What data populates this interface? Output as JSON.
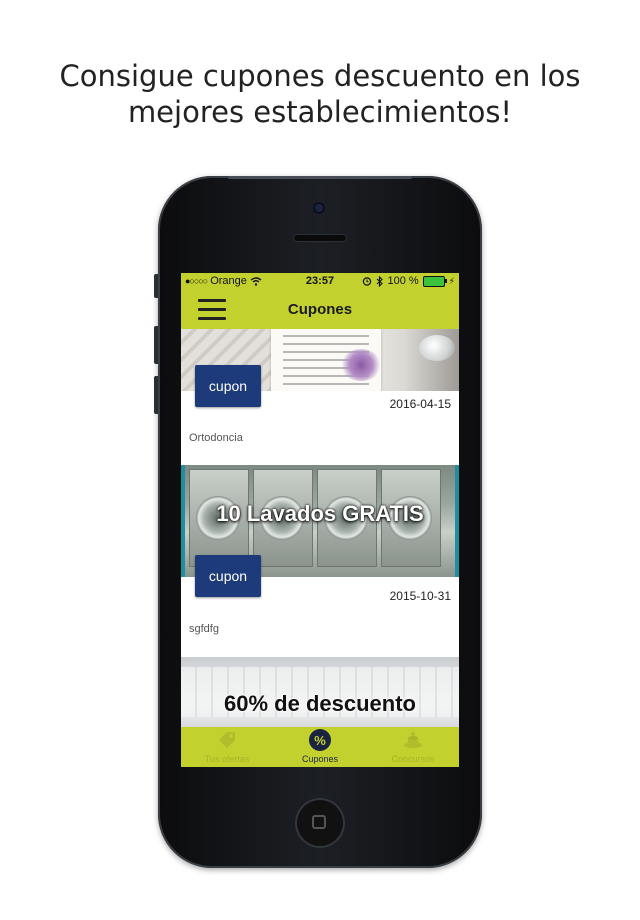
{
  "headline": {
    "line1": "Consigue cupones descuento en los",
    "line2": "mejores establecimientos!"
  },
  "status_bar": {
    "carrier": "Orange",
    "signal": "●○○○○",
    "time": "23:57",
    "battery": "100 %"
  },
  "nav": {
    "title": "Cupones"
  },
  "coupons": [
    {
      "button_label": "cupon",
      "date": "2016-04-15",
      "category": "Ortodoncia"
    },
    {
      "overlay_text": "10 Lavados GRATIS",
      "button_label": "cupon",
      "date": "2015-10-31",
      "category": "sgfdfg"
    },
    {
      "overlay_text": "60% de descuento"
    }
  ],
  "tabs": [
    {
      "label": "Tus ofertas",
      "icon": "tag-icon",
      "active": false
    },
    {
      "label": "Cupones",
      "icon": "percent-icon",
      "active": true
    },
    {
      "label": "Concursos",
      "icon": "trophy-icon",
      "active": false
    }
  ],
  "colors": {
    "accent": "#c3d12e",
    "button_blue": "#1d3b7a",
    "dark_navy": "#1a2340"
  }
}
